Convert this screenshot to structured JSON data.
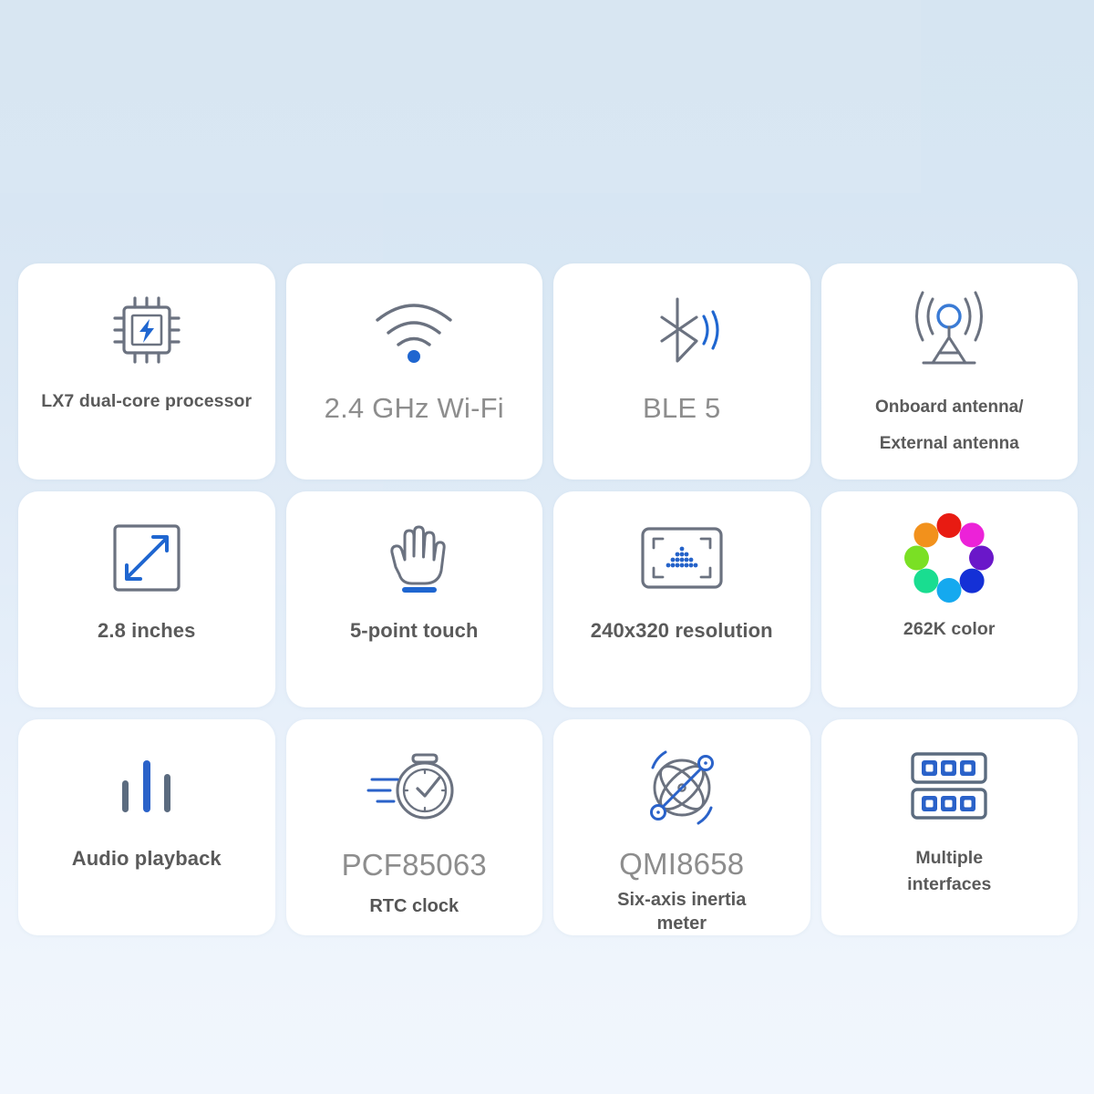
{
  "page": {
    "background_top_color": "#d6e5f2",
    "background_bottom_color": "#f1f6fd",
    "card_background": "#ffffff",
    "accent_blue": "#1f66d0",
    "icon_gray": "#6b7280",
    "text_gray": "#5a5a5a",
    "text_light_gray": "#8d8d8d"
  },
  "grid": {
    "columns": 4,
    "rows": 3,
    "cards": [
      {
        "id": "lx7-processor",
        "icon": "cpu-chip-icon",
        "label": "LX7 dual-core processor",
        "label_style": "small"
      },
      {
        "id": "wifi",
        "icon": "wifi-icon",
        "label": "2.4 GHz Wi-Fi",
        "label_style": "large"
      },
      {
        "id": "ble5",
        "icon": "bluetooth-icon",
        "label": "BLE 5",
        "label_style": "large"
      },
      {
        "id": "antenna",
        "icon": "antenna-tower-icon",
        "label_line1": "Onboard antenna/",
        "label_line2": "External antenna",
        "label_style": "two-line"
      },
      {
        "id": "screen-size",
        "icon": "diagonal-arrows-icon",
        "label": "2.8 inches",
        "label_style": "medium"
      },
      {
        "id": "touch",
        "icon": "hand-touch-icon",
        "label": "5-point touch",
        "label_style": "medium"
      },
      {
        "id": "resolution",
        "icon": "resolution-frame-icon",
        "label": "240x320 resolution",
        "label_style": "medium"
      },
      {
        "id": "color-depth",
        "icon": "color-wheel-icon",
        "label": "262K color",
        "label_style": "small"
      },
      {
        "id": "audio",
        "icon": "audio-bars-icon",
        "label": "Audio playback",
        "label_style": "medium"
      },
      {
        "id": "rtc-clock",
        "icon": "stopwatch-icon",
        "label": "PCF85063",
        "sublabel": "RTC clock",
        "label_style": "large-with-sub"
      },
      {
        "id": "imu",
        "icon": "gyroscope-icon",
        "label": "QMI8658",
        "sublabel_line1": "Six-axis inertia",
        "sublabel_line2": "meter",
        "label_style": "large-with-sub2"
      },
      {
        "id": "interfaces",
        "icon": "connector-ports-icon",
        "label_line1": "Multiple",
        "label_line2": "interfaces",
        "label_style": "two-line-tight"
      }
    ]
  },
  "color_wheel": {
    "colors": [
      "#e81b12",
      "#ec22d8",
      "#6a17c9",
      "#1430d6",
      "#15a9ef",
      "#19dd90",
      "#7ae024",
      "#f2911c"
    ]
  }
}
